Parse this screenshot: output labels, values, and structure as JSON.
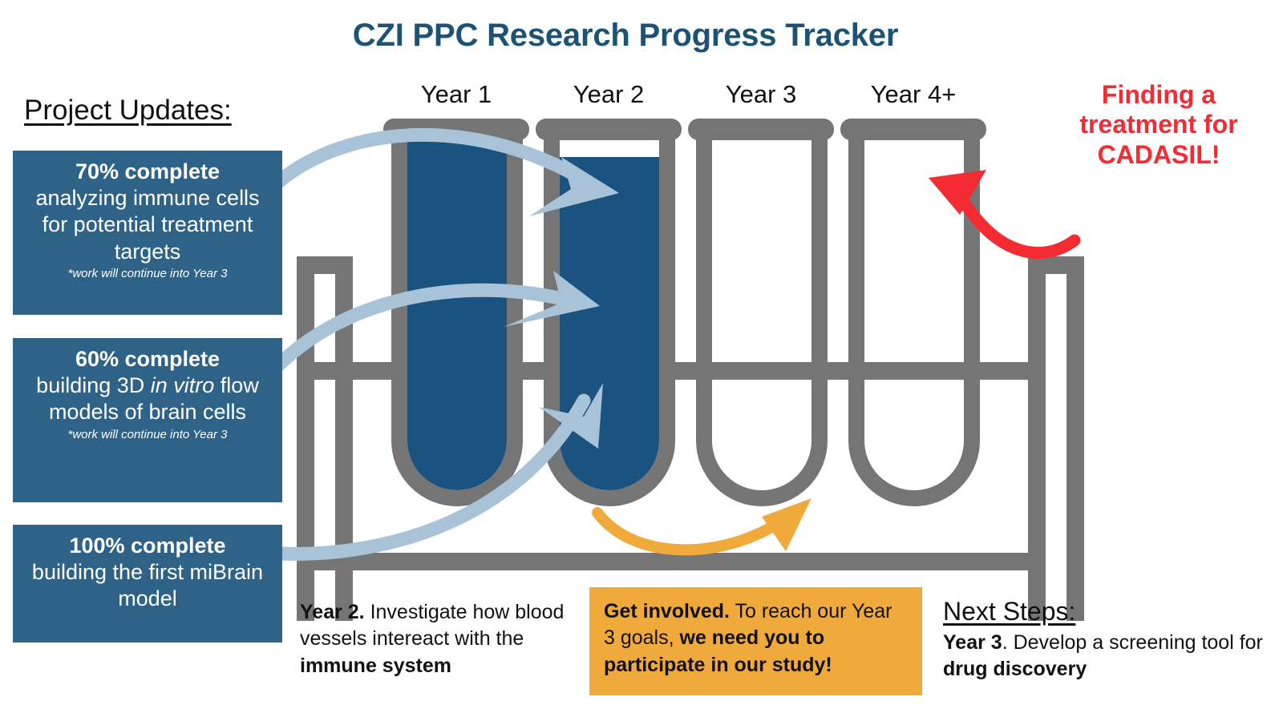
{
  "title": "CZI PPC Research Progress Tracker",
  "colors": {
    "title_blue": "#1c5374",
    "box_blue": "#2e6387",
    "tube_fill": "#1a5280",
    "rack_gray": "#757575",
    "accent_orange": "#f0a93b",
    "alert_red": "#f42b32",
    "arrow_blue": "#a8c2d8"
  },
  "sidebar": {
    "heading": "Project Updates:",
    "items": [
      {
        "percent": "70% complete",
        "description": "analyzing immune cells for potential treatment targets",
        "note": "*work will continue into Year 3"
      },
      {
        "percent": "60% complete",
        "description_pre": "building 3D ",
        "description_em": "in vitro",
        "description_post": " flow models of brain cells",
        "note": "*work will continue into Year 3"
      },
      {
        "percent": "100% complete",
        "description": "building the first miBrain model",
        "note": ""
      }
    ]
  },
  "timeline": {
    "year_labels": [
      "Year 1",
      "Year 2",
      "Year 3",
      "Year 4+"
    ],
    "tubes": [
      {
        "year": "Year 1",
        "filled": true,
        "fill_level": "full"
      },
      {
        "year": "Year 2",
        "filled": true,
        "fill_level": "partial"
      },
      {
        "year": "Year 3",
        "filled": false,
        "fill_level": "empty"
      },
      {
        "year": "Year 4+",
        "filled": false,
        "fill_level": "empty"
      }
    ]
  },
  "callout": {
    "line1": "Finding a",
    "line2": "treatment for",
    "line3": "CADASIL!"
  },
  "bottom": {
    "year2_note": {
      "label": "Year 2.",
      "text_pre": " Investigate how blood vessels intereact with the ",
      "text_bold": "immune system"
    },
    "get_involved": {
      "label": "Get  involved.",
      "text_pre": " To reach our Year 3 goals, ",
      "text_bold": "we need you to participate in our study!"
    },
    "next_steps": {
      "heading": "Next Steps:",
      "label": "Year 3",
      "text_pre": ". Develop a screening tool for ",
      "text_bold": "drug discovery"
    }
  },
  "arrows": {
    "blue_arrow_count": 3,
    "orange_arrow": "progress-to-year-3",
    "red_arrow": "points-to-year-4-tube"
  }
}
